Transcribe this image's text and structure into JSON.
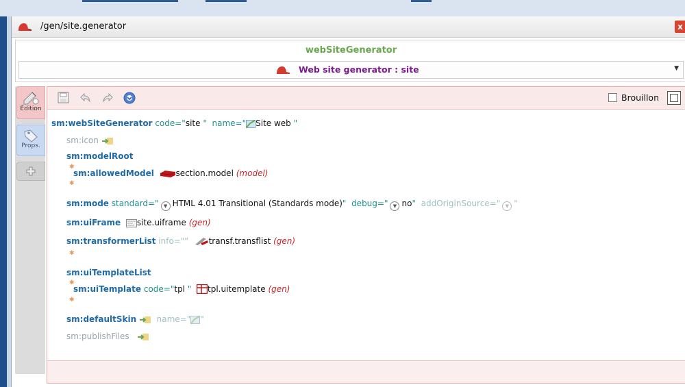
{
  "window": {
    "title": "/gen/site.generator",
    "close_label": "x"
  },
  "header": {
    "app_name": "webSiteGenerator",
    "model_label": "Web site generator : site"
  },
  "tabs": {
    "edition": "Édition",
    "props": "Props."
  },
  "toolbar": {
    "draft_label": "Brouillon"
  },
  "tree": {
    "root": {
      "tag": "sm:webSiteGenerator",
      "code_attr": "code=\"",
      "code_val": "site",
      "name_attr": "name=\"",
      "name_val": "Site web",
      "quote": "\""
    },
    "icon": {
      "tag": "sm:icon"
    },
    "modelRoot": {
      "tag": "sm:modelRoot"
    },
    "allowedModel": {
      "tag": "sm:allowedModel",
      "ref": "section.model",
      "kind": "(model)"
    },
    "mode": {
      "tag": "sm:mode",
      "standard_attr": "standard=\"",
      "standard_val": "HTML 4.01 Transitional (Standards mode)",
      "debug_attr": "debug=\"",
      "debug_val": "no",
      "origin_attr": "addOriginSource=\"",
      "quote": "\""
    },
    "uiFrame": {
      "tag": "sm:uiFrame",
      "ref": "site.uiframe",
      "kind": "(gen)"
    },
    "transformerList": {
      "tag": "sm:transformerList",
      "info_attr": "info=\"",
      "quote": "\"",
      "ref": "transf.transflist",
      "kind": "(gen)"
    },
    "uiTemplateList": {
      "tag": "sm:uiTemplateList"
    },
    "uiTemplate": {
      "tag": "sm:uiTemplate",
      "code_attr": "code=\"",
      "code_val": "tpl",
      "quote": "\"",
      "ref": "tpl.uitemplate",
      "kind": "(gen)"
    },
    "defaultSkin": {
      "tag": "sm:defaultSkin",
      "name_attr": "name=\"",
      "quote": "\""
    },
    "publishFiles": {
      "tag": "sm:publishFiles"
    }
  },
  "colors": {
    "app_name": "#6aa84f",
    "model_label": "#7a1c8c",
    "tag": "#1f6aa8",
    "attr": "#1e8f8f",
    "gen_ref": "#c62828",
    "edition_tab": "#f3c7c7",
    "props_tab": "#c9d9f2"
  }
}
